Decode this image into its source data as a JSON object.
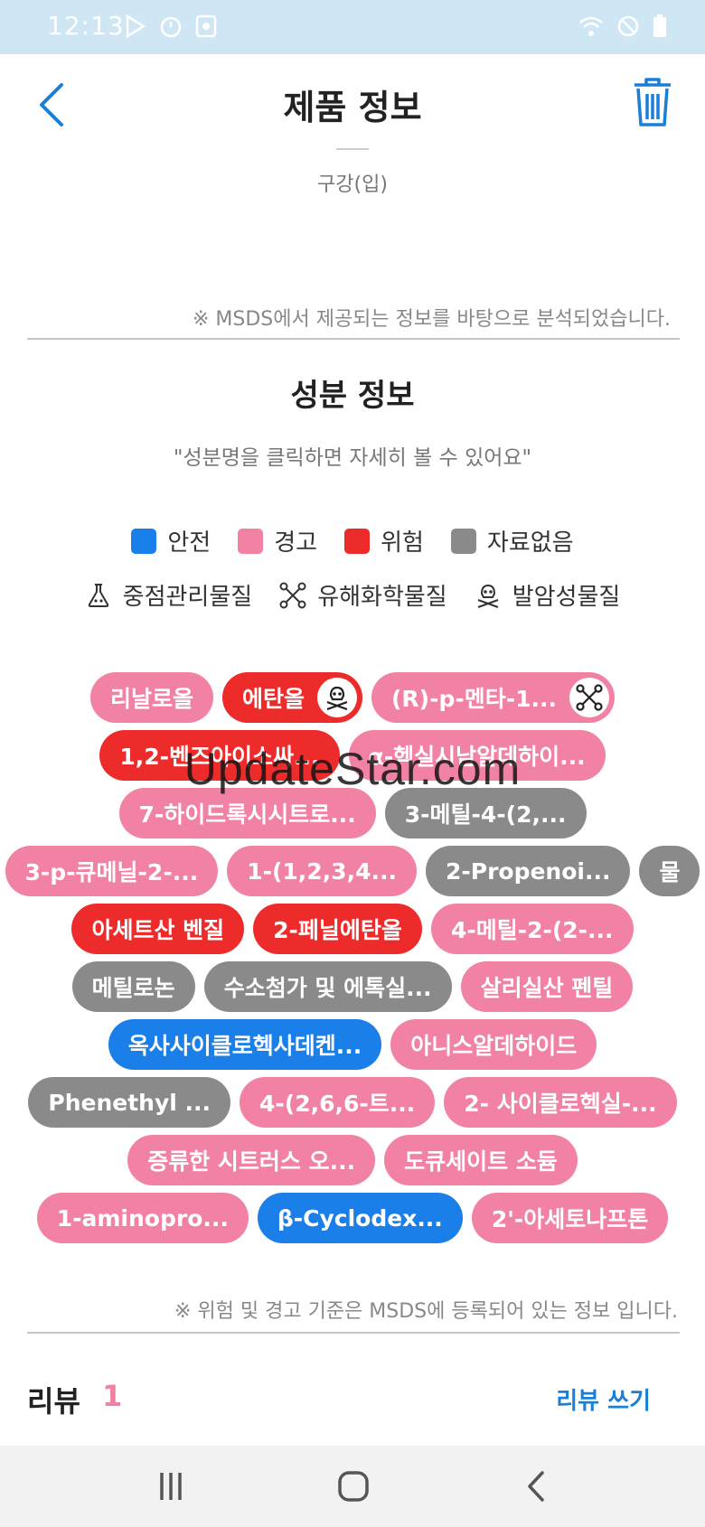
{
  "colors": {
    "safe": "#1a7fe8",
    "warning": "#f282a4",
    "danger": "#ee2b2b",
    "no_data": "#8a8a8a",
    "accent": "#1a7fd6"
  },
  "status_bar": {
    "time": "12:13"
  },
  "header": {
    "title": "제품 정보"
  },
  "route": {
    "text": "구강(입)"
  },
  "msds_note": "※ MSDS에서 제공되는 정보를 바탕으로 분석되었습니다.",
  "ingredients": {
    "title": "성분 정보",
    "hint": "\"성분명을 클릭하면 자세히 볼 수 있어요\"",
    "legend": {
      "safe": "안전",
      "warning": "경고",
      "danger": "위험",
      "no_data": "자료없음",
      "managed": "중점관리물질",
      "hazardous": "유해화학물질",
      "carcinogen": "발암성물질"
    },
    "rows": [
      [
        {
          "label": "리날로올",
          "level": "warning"
        },
        {
          "label": "에탄올",
          "level": "danger",
          "icon": "skull"
        },
        {
          "label": "(R)-p-멘타-1...",
          "level": "warning",
          "icon": "molecule"
        }
      ],
      [
        {
          "label": "1,2-벤즈아이소싸...",
          "level": "danger"
        },
        {
          "label": "α-헥실시남알데하이...",
          "level": "warning"
        }
      ],
      [
        {
          "label": "7-하이드록시시트로...",
          "level": "warning"
        },
        {
          "label": "3-메틸-4-(2,...",
          "level": "no_data"
        }
      ],
      [
        {
          "label": "3-p-큐메닐-2-...",
          "level": "warning"
        },
        {
          "label": "1-(1,2,3,4...",
          "level": "warning"
        },
        {
          "label": "2-Propenoi...",
          "level": "no_data"
        },
        {
          "label": "물",
          "level": "no_data"
        }
      ],
      [
        {
          "label": "아세트산 벤질",
          "level": "danger"
        },
        {
          "label": "2-페닐에탄올",
          "level": "danger"
        },
        {
          "label": "4-메틸-2-(2-...",
          "level": "warning"
        }
      ],
      [
        {
          "label": "메틸로논",
          "level": "no_data"
        },
        {
          "label": "수소첨가 및 에톡실...",
          "level": "no_data"
        },
        {
          "label": "살리실산 펜틸",
          "level": "warning"
        }
      ],
      [
        {
          "label": "옥사사이클로헥사데켄...",
          "level": "safe"
        },
        {
          "label": "아니스알데하이드",
          "level": "warning"
        }
      ],
      [
        {
          "label": "Phenethyl ...",
          "level": "no_data"
        },
        {
          "label": "4-(2,6,6-트...",
          "level": "warning"
        },
        {
          "label": "2- 사이클로헥실-...",
          "level": "warning"
        }
      ],
      [
        {
          "label": "증류한 시트러스 오...",
          "level": "warning"
        },
        {
          "label": "도큐세이트 소듐",
          "level": "warning"
        }
      ],
      [
        {
          "label": "1-aminopro...",
          "level": "warning"
        },
        {
          "label": "β-Cyclodex...",
          "level": "safe"
        },
        {
          "label": "2'-아세토나프톤",
          "level": "warning"
        }
      ]
    ]
  },
  "bottom_note": "※ 위험 및 경고 기준은 MSDS에 등록되어 있는 정보 입니다.",
  "review": {
    "label": "리뷰",
    "count": "1",
    "write_label": "리뷰 쓰기"
  },
  "watermark": "UpdateStar.com"
}
